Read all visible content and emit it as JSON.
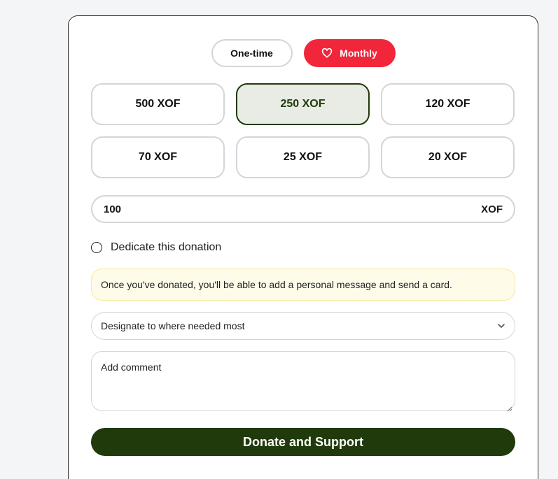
{
  "frequency": {
    "onetime_label": "One-time",
    "monthly_label": "Monthly",
    "selected": "Monthly"
  },
  "amounts": [
    {
      "label": "500 XOF"
    },
    {
      "label": "250 XOF",
      "selected": true
    },
    {
      "label": "120 XOF"
    },
    {
      "label": "70 XOF"
    },
    {
      "label": "25 XOF"
    },
    {
      "label": "20 XOF"
    }
  ],
  "custom_amount": {
    "value": "100",
    "currency": "XOF"
  },
  "dedicate": {
    "label": "Dedicate this donation",
    "checked": false
  },
  "notice": {
    "text": "Once you've donated, you'll be able to add a personal message and send a card."
  },
  "designation": {
    "selected": "Designate to where needed most"
  },
  "comment": {
    "placeholder": "Add comment"
  },
  "donate_button": {
    "label": "Donate and Support"
  },
  "colors": {
    "accent_red": "#f2263a",
    "primary_green": "#203a0b",
    "selected_bg": "#e8ece5",
    "notice_bg": "#fefbe8"
  }
}
